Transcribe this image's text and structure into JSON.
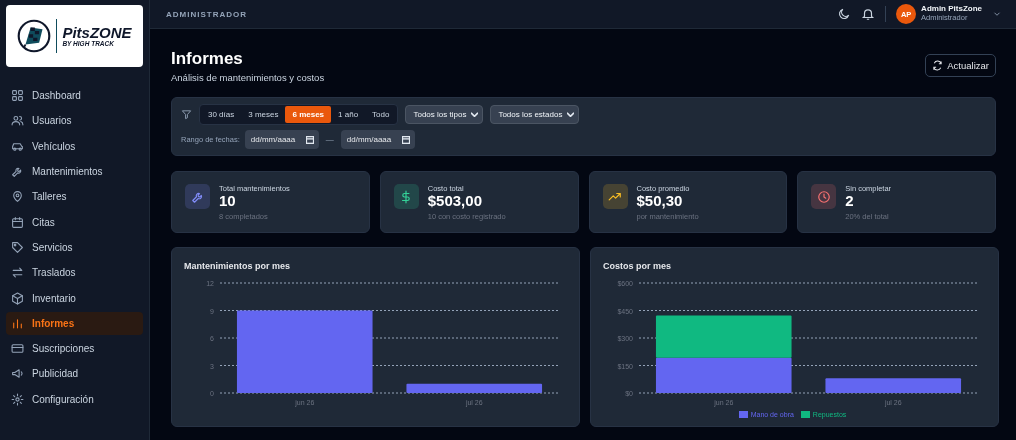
{
  "logo": {
    "name": "PitsZONE",
    "tagline": "BY HIGH TRACK"
  },
  "sidebar": {
    "items": [
      {
        "label": "Dashboard",
        "selected": false
      },
      {
        "label": "Usuarios",
        "selected": false
      },
      {
        "label": "Vehículos",
        "selected": false
      },
      {
        "label": "Mantenimientos",
        "selected": false
      },
      {
        "label": "Talleres",
        "selected": false
      },
      {
        "label": "Citas",
        "selected": false
      },
      {
        "label": "Servicios",
        "selected": false
      },
      {
        "label": "Traslados",
        "selected": false
      },
      {
        "label": "Inventario",
        "selected": false
      },
      {
        "label": "Informes",
        "selected": true
      },
      {
        "label": "Suscripciones",
        "selected": false
      },
      {
        "label": "Publicidad",
        "selected": false
      },
      {
        "label": "Configuración",
        "selected": false
      }
    ]
  },
  "topbar": {
    "section": "ADMINISTRADOR",
    "user": {
      "initials": "AP",
      "name": "Admin PitsZone",
      "role": "Administrador"
    }
  },
  "header": {
    "title": "Informes",
    "subtitle": "Análisis de mantenimientos y costos",
    "refresh_button": "Actualizar"
  },
  "filters": {
    "periods": [
      {
        "label": "30 días",
        "selected": false
      },
      {
        "label": "3 meses",
        "selected": false
      },
      {
        "label": "6 meses",
        "selected": true
      },
      {
        "label": "1 año",
        "selected": false
      },
      {
        "label": "Todo",
        "selected": false
      }
    ],
    "type_select": "Todos los tipos",
    "status_select": "Todos los estados",
    "date_range_label": "Rango de fechas:",
    "date_from": {
      "placeholder": "dd/mm/aaaa"
    },
    "date_separator": "—",
    "date_to": {
      "placeholder": "dd/mm/aaaa"
    }
  },
  "stats": [
    {
      "label": "Total mantenimientos",
      "value": "10",
      "note": "8 completados",
      "color": "#818cf8"
    },
    {
      "label": "Costo total",
      "value": "$503,00",
      "note": "10 con costo registrado",
      "color": "#34d399"
    },
    {
      "label": "Costo promedio",
      "value": "$50,30",
      "note": "por mantenimiento",
      "color": "#fbbf24"
    },
    {
      "label": "Sin completar",
      "value": "2",
      "note": "20% del total",
      "color": "#f87171"
    }
  ],
  "charts": [
    {
      "title": "Mantenimientos por mes",
      "chart_data": {
        "type": "bar",
        "categories": [
          "jun 26",
          "jul 26"
        ],
        "values": [
          9,
          1
        ],
        "ylim": [
          0,
          12
        ],
        "yticks": [
          0,
          3,
          6,
          9,
          12
        ],
        "stacked": false,
        "grid": true
      }
    },
    {
      "title": "Costos por mes",
      "chart_data": {
        "type": "bar",
        "categories": [
          "jun 26",
          "jul 26"
        ],
        "series": [
          {
            "name": "Mano de obra",
            "color": "#6366f1",
            "values": [
              192,
              80
            ]
          },
          {
            "name": "Repuestos",
            "color": "#10b981",
            "values": [
              231,
              0
            ]
          }
        ],
        "ylim": [
          0,
          600
        ],
        "yticks": [
          {
            "value": 0,
            "label": "$0"
          },
          {
            "value": 150,
            "label": "$150"
          },
          {
            "value": 300,
            "label": "$300"
          },
          {
            "value": 450,
            "label": "$450"
          },
          {
            "value": 600,
            "label": "$600"
          }
        ],
        "stacked": true,
        "grid": true
      }
    }
  ]
}
